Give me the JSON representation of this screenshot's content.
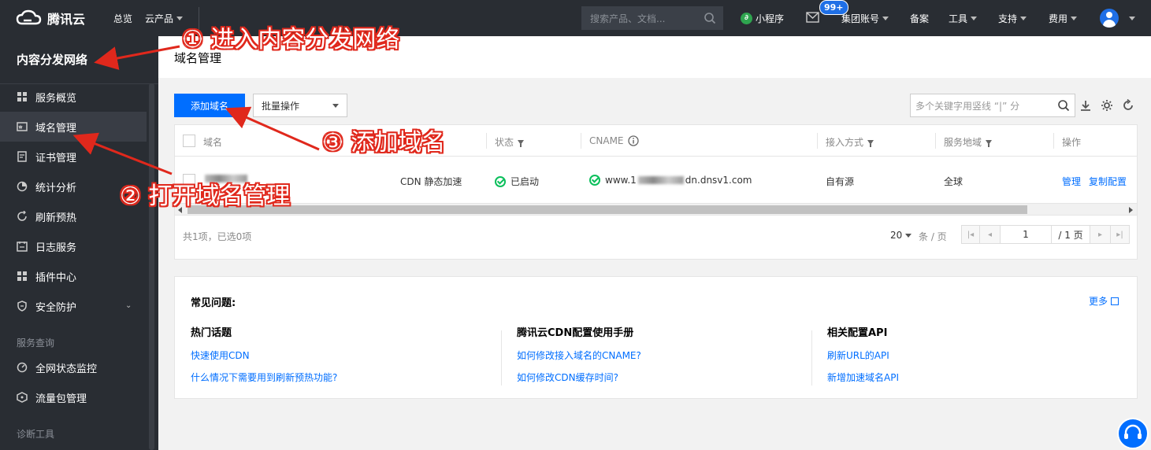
{
  "topbar": {
    "brand": "腾讯云",
    "nav_overview": "总览",
    "nav_products": "云产品",
    "search_placeholder": "搜索产品、文档...",
    "mini_program": "小程序",
    "badge": "99+",
    "account": "集团账号",
    "filing": "备案",
    "tools": "工具",
    "support": "支持",
    "billing": "费用"
  },
  "sidebar": {
    "title": "内容分发网络",
    "items": [
      {
        "label": "服务概览",
        "icon": "grid-icon"
      },
      {
        "label": "域名管理",
        "icon": "domain-icon"
      },
      {
        "label": "证书管理",
        "icon": "certificate-icon"
      },
      {
        "label": "统计分析",
        "icon": "pie-chart-icon"
      },
      {
        "label": "刷新预热",
        "icon": "refresh-icon"
      },
      {
        "label": "日志服务",
        "icon": "log-icon"
      },
      {
        "label": "插件中心",
        "icon": "plugin-icon"
      },
      {
        "label": "安全防护",
        "icon": "shield-icon"
      },
      {
        "label": "全网状态监控",
        "icon": "monitor-icon"
      },
      {
        "label": "流量包管理",
        "icon": "package-icon"
      }
    ],
    "group_query": "服务查询",
    "group_diagnose": "诊断工具"
  },
  "page": {
    "title": "域名管理",
    "add_button": "添加域名",
    "batch_select": "批量操作",
    "search_placeholder": "多个关键字用竖线 “|” 分"
  },
  "table": {
    "headers": {
      "domain": "域名",
      "status": "状态",
      "cname": "CNAME",
      "access": "接入方式",
      "region": "服务地域",
      "actions": "操作"
    },
    "rows": [
      {
        "service_type": "CDN 静态加速",
        "status": "已启动",
        "cname_prefix": "www.1",
        "cname_suffix": "dn.dnsv1.com",
        "access": "自有源",
        "region": "全球",
        "action_manage": "管理",
        "action_copy": "复制配置"
      }
    ],
    "summary": "共1项，已选0项",
    "page_size": "20",
    "per_page_label": "条 / 页",
    "current_page": "1",
    "total_pages": "/ 1 页"
  },
  "faq": {
    "title": "常见问题:",
    "more": "更多",
    "columns": [
      {
        "title": "热门话题",
        "links": [
          "快速使用CDN",
          "什么情况下需要用到刷新预热功能?"
        ]
      },
      {
        "title": "腾讯云CDN配置使用手册",
        "links": [
          "如何修改接入域名的CNAME?",
          "如何修改CDN缓存时间?"
        ]
      },
      {
        "title": "相关配置API",
        "links": [
          "刷新URL的API",
          "新增加速域名API"
        ]
      }
    ]
  },
  "annotations": {
    "step1": "① 进入内容分发网络",
    "step2": "② 打开域名管理",
    "step3": "③ 添加域名"
  },
  "colors": {
    "primary": "#006eff",
    "topbar": "#292d33",
    "success": "#0abf5b",
    "annotation": "#e0281c"
  }
}
